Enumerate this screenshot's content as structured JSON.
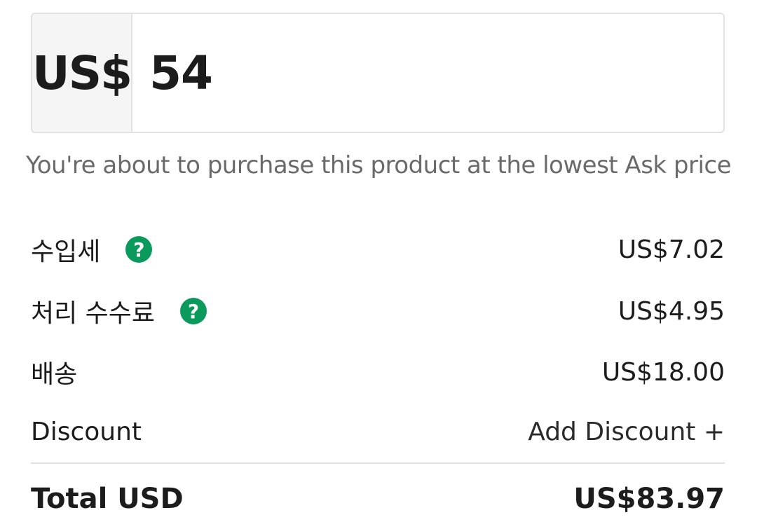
{
  "price_input": {
    "currency": "US$",
    "amount": "54"
  },
  "notice": "You're about to purchase this product at the lowest Ask price",
  "fees": {
    "import_duty": {
      "label": "수입세",
      "value": "US$7.02",
      "icon": "help-icon"
    },
    "processing_fee": {
      "label": "처리 수수료",
      "value": "US$4.95",
      "icon": "help-icon"
    },
    "shipping": {
      "label": "배송",
      "value": "US$18.00"
    }
  },
  "discount": {
    "label": "Discount",
    "action": "Add Discount +"
  },
  "total": {
    "label": "Total USD",
    "value": "US$83.97"
  },
  "colors": {
    "help_icon": "#0a9b5c",
    "border": "#e2e2e2",
    "currency_bg": "#f5f5f5"
  }
}
